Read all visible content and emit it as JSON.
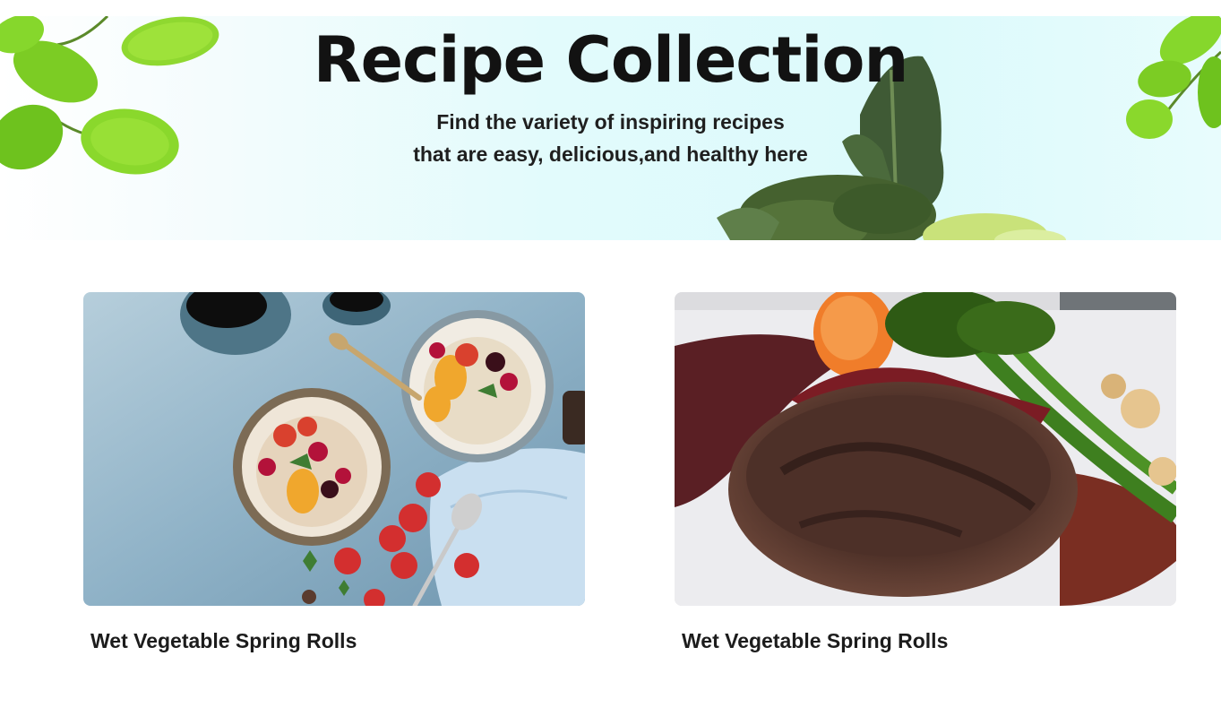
{
  "hero": {
    "title": "Recipe Collection",
    "subtitle_line1": "Find the variety of inspiring recipes",
    "subtitle_line2": "that are easy, delicious,and healthy here"
  },
  "recipes": [
    {
      "title": "Wet Vegetable Spring Rolls",
      "image": "oatmeal-bowls-with-berries-photo"
    },
    {
      "title": "Wet Vegetable Spring Rolls",
      "image": "glazed-steak-with-broccolini-photo"
    }
  ],
  "colors": {
    "hero_background": "#dcfafb",
    "leaf_green": "#7ed321",
    "text_dark": "#121212"
  }
}
